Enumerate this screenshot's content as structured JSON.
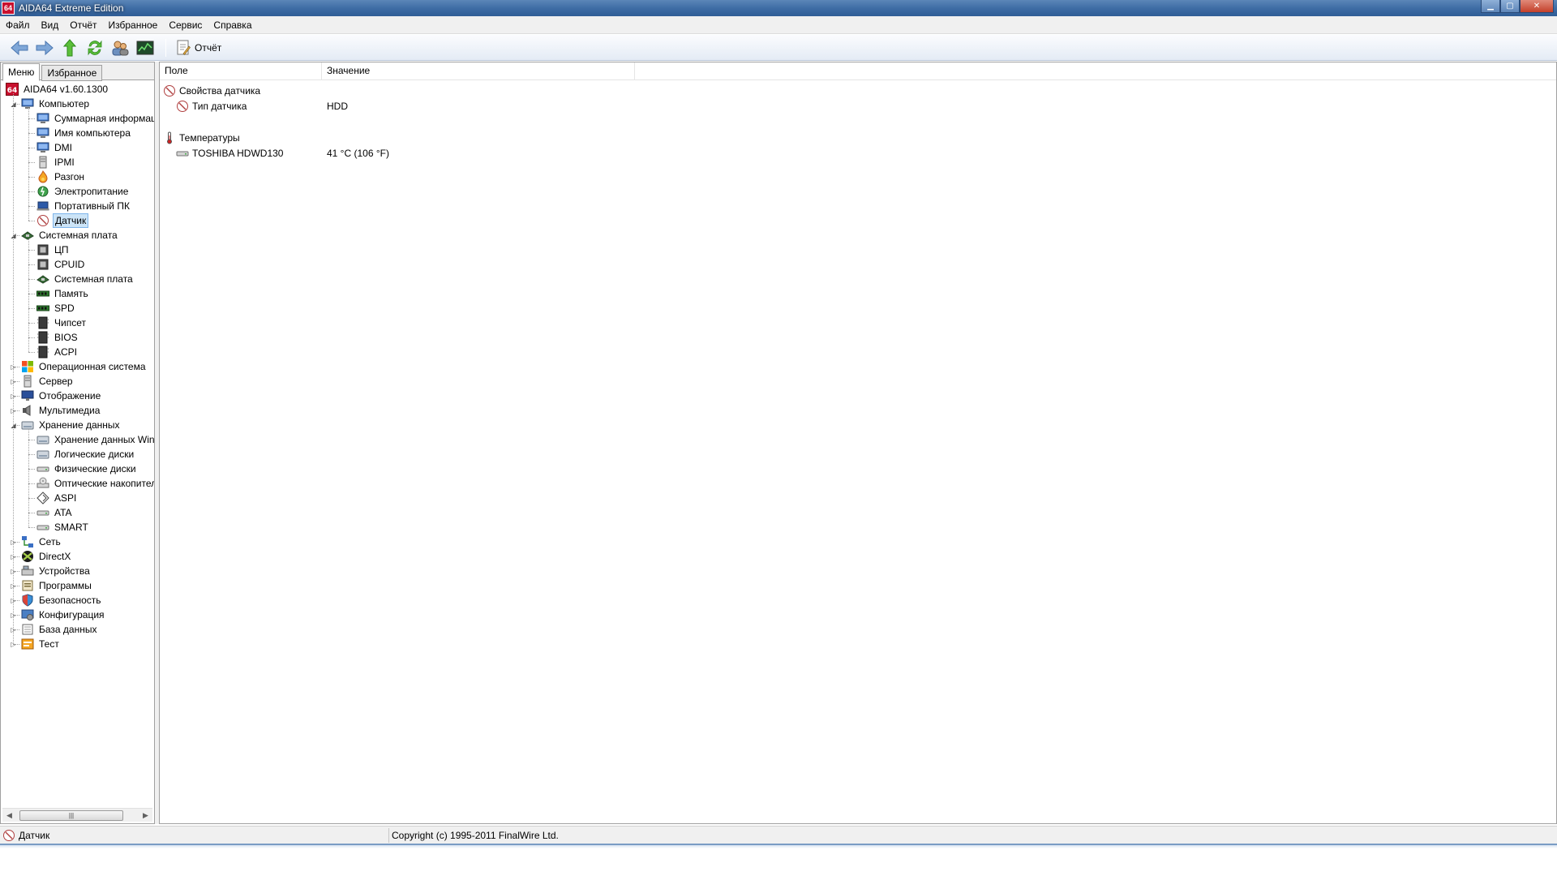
{
  "window": {
    "title": "AIDA64 Extreme Edition",
    "logo_text": "64"
  },
  "menubar": [
    "Файл",
    "Вид",
    "Отчёт",
    "Избранное",
    "Сервис",
    "Справка"
  ],
  "toolbar": {
    "report_label": "Отчёт"
  },
  "left_tabs": {
    "menu": "Меню",
    "favorites": "Избранное"
  },
  "tree": [
    {
      "label": "AIDA64 v1.60.1300",
      "level": 0,
      "icon": "aida-icon",
      "expander": ""
    },
    {
      "label": "Компьютер",
      "level": 1,
      "icon": "computer-icon",
      "expander": "open"
    },
    {
      "label": "Суммарная информация",
      "level": 2,
      "icon": "computer-icon",
      "expander": ""
    },
    {
      "label": "Имя компьютера",
      "level": 2,
      "icon": "computer-icon",
      "expander": ""
    },
    {
      "label": "DMI",
      "level": 2,
      "icon": "computer-icon",
      "expander": ""
    },
    {
      "label": "IPMI",
      "level": 2,
      "icon": "server-icon",
      "expander": ""
    },
    {
      "label": "Разгон",
      "level": 2,
      "icon": "flame-icon",
      "expander": ""
    },
    {
      "label": "Электропитание",
      "level": 2,
      "icon": "power-icon",
      "expander": ""
    },
    {
      "label": "Портативный ПК",
      "level": 2,
      "icon": "laptop-icon",
      "expander": ""
    },
    {
      "label": "Датчик",
      "level": 2,
      "icon": "gauge-icon",
      "expander": "",
      "selected": true
    },
    {
      "label": "Системная плата",
      "level": 1,
      "icon": "motherboard-icon",
      "expander": "open"
    },
    {
      "label": "ЦП",
      "level": 2,
      "icon": "cpu-icon",
      "expander": ""
    },
    {
      "label": "CPUID",
      "level": 2,
      "icon": "cpu-icon",
      "expander": ""
    },
    {
      "label": "Системная плата",
      "level": 2,
      "icon": "motherboard-icon",
      "expander": ""
    },
    {
      "label": "Память",
      "level": 2,
      "icon": "memory-icon",
      "expander": ""
    },
    {
      "label": "SPD",
      "level": 2,
      "icon": "memory-icon",
      "expander": ""
    },
    {
      "label": "Чипсет",
      "level": 2,
      "icon": "chip-icon",
      "expander": ""
    },
    {
      "label": "BIOS",
      "level": 2,
      "icon": "chip-icon",
      "expander": ""
    },
    {
      "label": "ACPI",
      "level": 2,
      "icon": "chip-icon",
      "expander": ""
    },
    {
      "label": "Операционная система",
      "level": 1,
      "icon": "windows-icon",
      "expander": "closed"
    },
    {
      "label": "Сервер",
      "level": 1,
      "icon": "server-icon",
      "expander": "closed"
    },
    {
      "label": "Отображение",
      "level": 1,
      "icon": "monitor-icon",
      "expander": "closed"
    },
    {
      "label": "Мультимедиа",
      "level": 1,
      "icon": "speaker-icon",
      "expander": "closed"
    },
    {
      "label": "Хранение данных",
      "level": 1,
      "icon": "storage-icon",
      "expander": "open"
    },
    {
      "label": "Хранение данных Windows",
      "level": 2,
      "icon": "storage-icon",
      "expander": ""
    },
    {
      "label": "Логические диски",
      "level": 2,
      "icon": "storage-icon",
      "expander": ""
    },
    {
      "label": "Физические диски",
      "level": 2,
      "icon": "drive-icon",
      "expander": ""
    },
    {
      "label": "Оптические накопители",
      "level": 2,
      "icon": "optical-icon",
      "expander": ""
    },
    {
      "label": "ASPI",
      "level": 2,
      "icon": "aspi-icon",
      "expander": ""
    },
    {
      "label": "ATA",
      "level": 2,
      "icon": "drive-icon",
      "expander": ""
    },
    {
      "label": "SMART",
      "level": 2,
      "icon": "drive-icon",
      "expander": ""
    },
    {
      "label": "Сеть",
      "level": 1,
      "icon": "network-icon",
      "expander": "closed"
    },
    {
      "label": "DirectX",
      "level": 1,
      "icon": "directx-icon",
      "expander": "closed"
    },
    {
      "label": "Устройства",
      "level": 1,
      "icon": "devices-icon",
      "expander": "closed"
    },
    {
      "label": "Программы",
      "level": 1,
      "icon": "programs-icon",
      "expander": "closed"
    },
    {
      "label": "Безопасность",
      "level": 1,
      "icon": "shield-icon",
      "expander": "closed"
    },
    {
      "label": "Конфигурация",
      "level": 1,
      "icon": "config-icon",
      "expander": "closed"
    },
    {
      "label": "База данных",
      "level": 1,
      "icon": "database-icon",
      "expander": "closed"
    },
    {
      "label": "Тест",
      "level": 1,
      "icon": "benchmark-icon",
      "expander": "closed"
    }
  ],
  "columns": {
    "field": "Поле",
    "value": "Значение"
  },
  "rows": [
    {
      "type": "group",
      "field": "Свойства датчика",
      "value": "",
      "icon": "gauge-icon"
    },
    {
      "type": "item",
      "field": "Тип датчика",
      "value": "HDD",
      "icon": "gauge-icon"
    },
    {
      "type": "spacer"
    },
    {
      "type": "group",
      "field": "Температуры",
      "value": "",
      "icon": "thermometer-icon"
    },
    {
      "type": "item",
      "field": "TOSHIBA HDWD130",
      "value": "41 °C  (106 °F)",
      "icon": "drive-icon"
    }
  ],
  "statusbar": {
    "left": "Датчик",
    "right": "Copyright (c) 1995-2011 FinalWire Ltd."
  }
}
